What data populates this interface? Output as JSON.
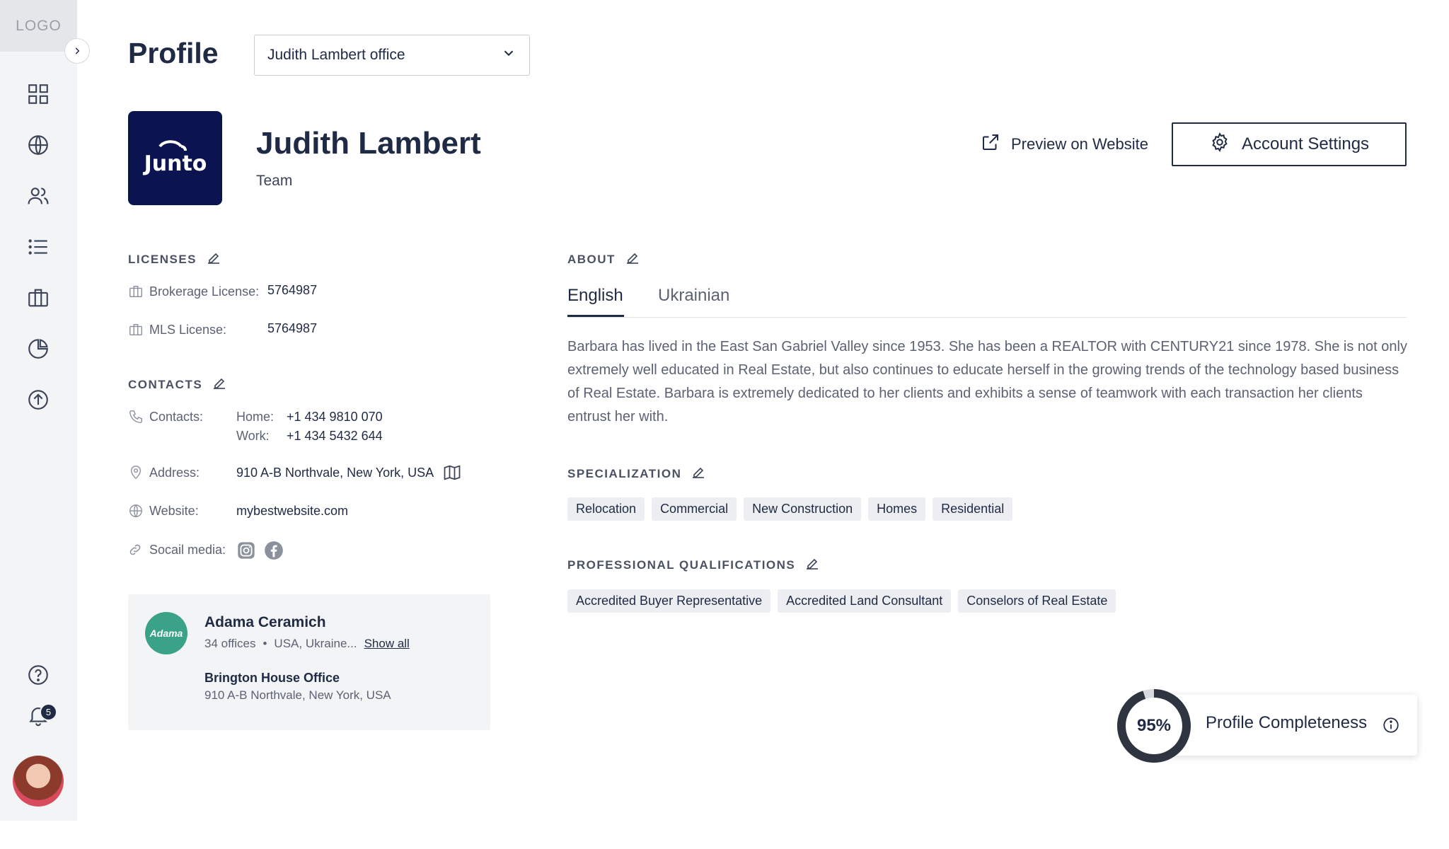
{
  "sidebar": {
    "logo": "LOGO",
    "items": [
      {
        "icon": "grid-icon"
      },
      {
        "icon": "globe-icon"
      },
      {
        "icon": "users-icon"
      },
      {
        "icon": "list-icon"
      },
      {
        "icon": "briefcase-icon"
      },
      {
        "icon": "pie-chart-icon"
      },
      {
        "icon": "upload-circle-icon"
      }
    ],
    "help_icon": "help-icon",
    "notifications_icon": "bell-icon",
    "notifications_count": "5"
  },
  "header": {
    "title": "Profile",
    "office_select": {
      "value": "Judith Lambert office"
    }
  },
  "profile": {
    "name": "Judith Lambert",
    "type": "Team",
    "logo_text": "Junto",
    "preview_label": "Preview on Website",
    "settings_label": "Account Settings"
  },
  "licenses": {
    "heading": "LICENSES",
    "items": [
      {
        "label": "Brokerage License:",
        "value": "5764987"
      },
      {
        "label": "MLS License:",
        "value": "5764987"
      }
    ]
  },
  "contacts": {
    "heading": "CONTACTS",
    "contacts_label": "Contacts:",
    "phones": [
      {
        "label": "Home:",
        "value": "+1 434 9810 070"
      },
      {
        "label": "Work:",
        "value": "+1 434 5432 644"
      }
    ],
    "address_label": "Address:",
    "address": "910 A-B Northvale, New York, USA",
    "website_label": "Website:",
    "website": "mybestwebsite.com",
    "social_label": "Socail media:"
  },
  "organization": {
    "logo_text": "Adama",
    "name": "Adama Ceramich",
    "offices": "34 offices",
    "bullet": "•",
    "locations": "USA, Ukraine...",
    "show_all": "Show all",
    "branch_name": "Brington House Office",
    "branch_address": "910 A-B Northvale, New York, USA"
  },
  "about": {
    "heading": "ABOUT",
    "tabs": [
      "English",
      "Ukrainian"
    ],
    "active_tab": "English",
    "text": "Barbara has lived in the East San Gabriel Valley since 1953. She has been a REALTOR with CENTURY21 since 1978. She is not only extremely well educated in Real Estate, but also continues to educate herself in the growing trends of the technology based business of Real Estate. Barbara is extremely dedicated to her clients and exhibits a sense of teamwork with each transaction her clients entrust her with."
  },
  "specialization": {
    "heading": "SPECIALIZATION",
    "chips": [
      "Relocation",
      "Commercial",
      "New Construction",
      "Homes",
      "Residential"
    ]
  },
  "qualifications": {
    "heading": "PROFESSIONAL QUALIFICATIONS",
    "chips": [
      "Accredited Buyer Representative",
      "Accredited Land Consultant",
      "Conselors of Real Estate"
    ]
  },
  "completeness": {
    "percent_label": "95%",
    "percent": 95,
    "label": "Profile Completeness"
  },
  "colors": {
    "primary": "#1f2a44",
    "brand_navy": "#0b1450",
    "org_green": "#3aa387",
    "sidebar_bg": "#f3f4f6"
  }
}
